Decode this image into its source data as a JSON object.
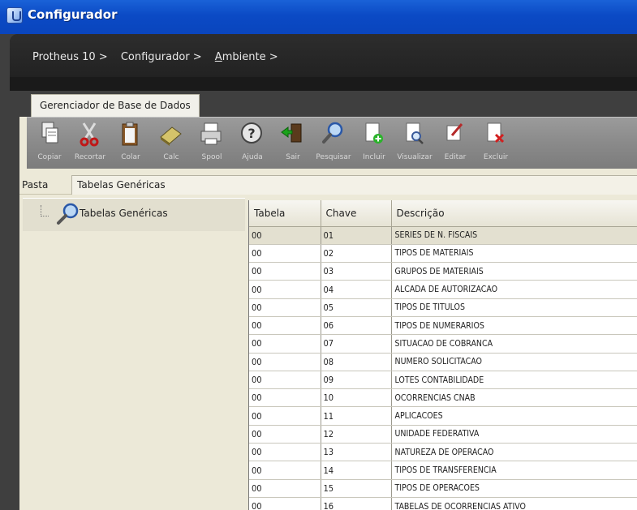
{
  "window": {
    "title": "Configurador",
    "icon": "protheus-app-icon"
  },
  "breadcrumb": [
    {
      "label": "Protheus 10 >"
    },
    {
      "label": "Configurador >"
    },
    {
      "label_underline": "A",
      "label_rest": "mbiente >"
    }
  ],
  "tabs": {
    "main": "Gerenciador de Base de Dados"
  },
  "toolbar": [
    {
      "label": "Copiar",
      "icon": "copy-icon"
    },
    {
      "label": "Recortar",
      "icon": "scissors-icon"
    },
    {
      "label": "Colar",
      "icon": "clipboard-icon"
    },
    {
      "label": "Calc",
      "icon": "calculator-icon"
    },
    {
      "label": "Spool",
      "icon": "spool-printer-icon"
    },
    {
      "label": "Ajuda",
      "icon": "help-icon"
    },
    {
      "label": "Sair",
      "icon": "exit-door-icon"
    },
    {
      "label": "Pesquisar",
      "icon": "search-magnifier-icon"
    },
    {
      "label": "Incluir",
      "icon": "add-document-icon"
    },
    {
      "label": "Visualizar",
      "icon": "view-document-icon"
    },
    {
      "label": "Editar",
      "icon": "edit-pencil-icon"
    },
    {
      "label": "Excluir",
      "icon": "delete-document-icon"
    }
  ],
  "pasta": {
    "label": "Pasta",
    "tab": "Tabelas Genéricas"
  },
  "tree": {
    "node_label": "Tabelas Genéricas",
    "node_icon": "search-magnifier-icon"
  },
  "grid": {
    "columns": [
      "Tabela",
      "Chave",
      "Descrição"
    ],
    "rows": [
      [
        "00",
        "01",
        "SERIES DE N. FISCAIS"
      ],
      [
        "00",
        "02",
        "TIPOS DE MATERIAIS"
      ],
      [
        "00",
        "03",
        "GRUPOS DE MATERIAIS"
      ],
      [
        "00",
        "04",
        "ALCADA DE AUTORIZACAO"
      ],
      [
        "00",
        "05",
        "TIPOS DE TITULOS"
      ],
      [
        "00",
        "06",
        "TIPOS DE NUMERARIOS"
      ],
      [
        "00",
        "07",
        "SITUACAO DE COBRANCA"
      ],
      [
        "00",
        "08",
        "NUMERO SOLICITACAO"
      ],
      [
        "00",
        "09",
        "LOTES CONTABILIDADE"
      ],
      [
        "00",
        "10",
        "OCORRENCIAS CNAB"
      ],
      [
        "00",
        "11",
        "APLICACOES"
      ],
      [
        "00",
        "12",
        "UNIDADE FEDERATIVA"
      ],
      [
        "00",
        "13",
        "NATUREZA DE OPERACAO"
      ],
      [
        "00",
        "14",
        "TIPOS DE TRANSFERENCIA"
      ],
      [
        "00",
        "15",
        "TIPOS DE OPERACOES"
      ],
      [
        "00",
        "16",
        "TABELAS DE OCORRENCIAS ATIVO"
      ]
    ]
  },
  "colors": {
    "title_bar": "#0b4ac5",
    "selected_row": "#e3e0d0",
    "panel": "#ece9d8"
  }
}
